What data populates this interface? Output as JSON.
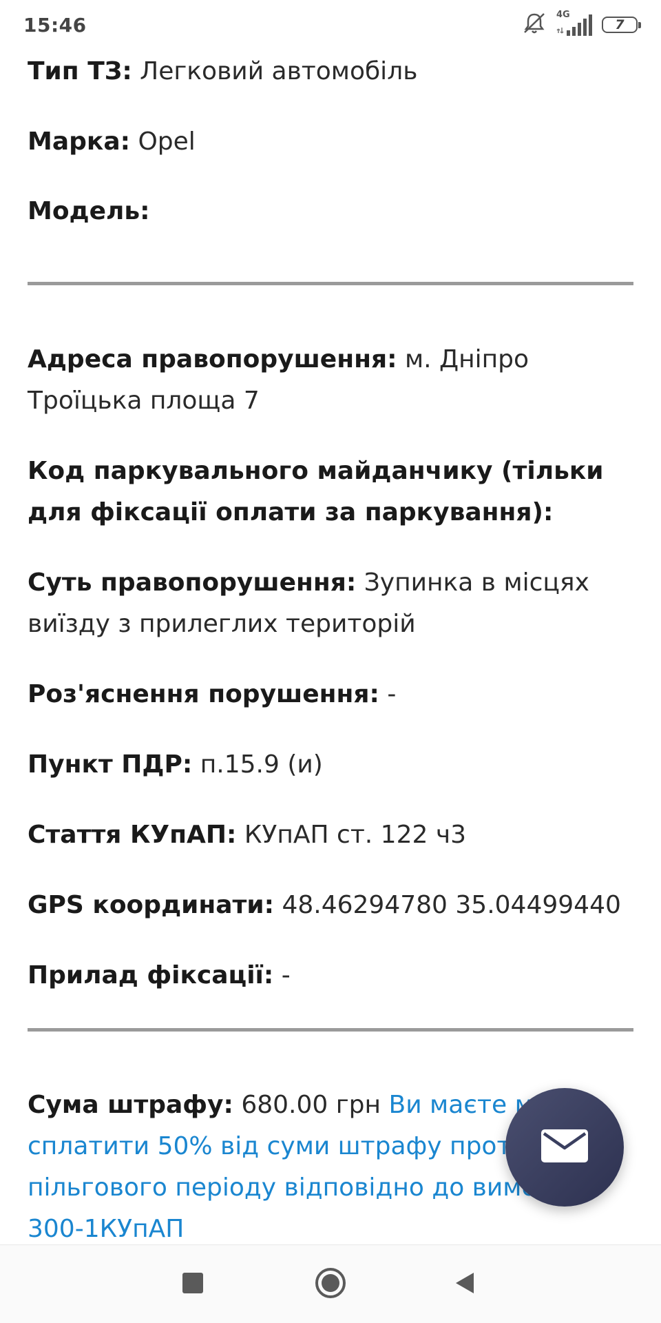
{
  "status_bar": {
    "time": "15:46",
    "network": "4G",
    "battery": "7",
    "icons": [
      "mute-icon",
      "signal-icon",
      "battery-icon"
    ]
  },
  "vehicle": {
    "type_label": "Тип ТЗ:",
    "type_value": "Легковий автомобіль",
    "brand_label": "Марка:",
    "brand_value": "Opel",
    "model_label": "Модель:"
  },
  "violation": {
    "address_label": "Адреса правопорушення:",
    "address_value": "м. Дніпро Троїцька площа 7",
    "parking_code_label": "Код паркувального майданчику (тільки для фіксації оплати за паркування):",
    "essence_label": "Суть правопорушення:",
    "essence_value": "Зупинка в місцях виїзду з прилеглих територій",
    "explanation_label": "Роз'яснення порушення:",
    "explanation_value": "-",
    "pdr_label": "Пункт ПДР:",
    "pdr_value": "п.15.9 (и)",
    "kupap_label": "Стаття КУпАП:",
    "kupap_value": "КУпАП ст. 122 ч3",
    "gps_label": "GPS координати:",
    "gps_value": "48.46294780 35.04499440",
    "device_label": "Прилад фіксації:",
    "device_value": "-"
  },
  "fine": {
    "label": "Сума штрафу:",
    "amount": "680.00 грн",
    "discount_text": "Ви маєте можл... сплатити 50% від суми штрафу протяг... пільгового періоду відповідно до вимог... 300-1КУпАП",
    "line1": "Ви маєте можл",
    "line2": "сплатити 50% від суми штрафу протяг",
    "line3": "пільгового періоду відповідно до вимог",
    "line4": "300-1КУпАП"
  },
  "fab": {
    "icon": "mail-icon"
  },
  "nav": {
    "icons": [
      "recents-square-icon",
      "home-circle-icon",
      "back-triangle-icon"
    ]
  },
  "colors": {
    "link": "#1a86d0",
    "fab": "#3a3f5f",
    "divider": "#9a9a9a"
  }
}
